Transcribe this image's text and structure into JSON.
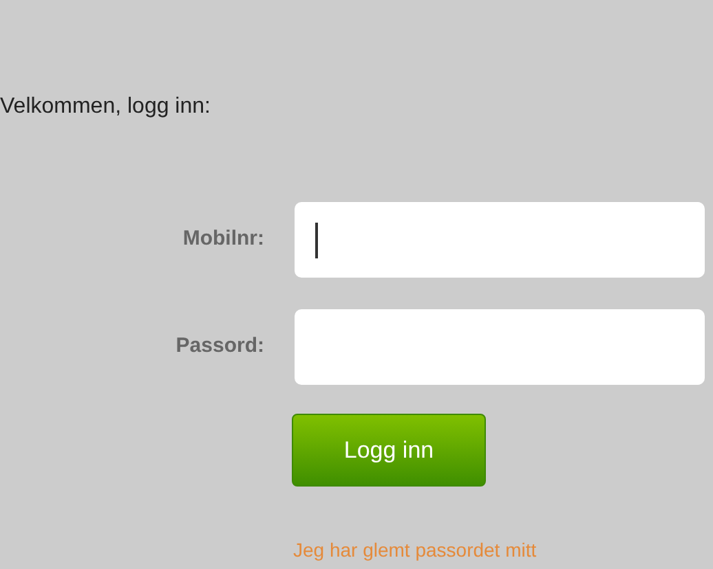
{
  "heading": "Velkommen, logg inn:",
  "fields": [
    {
      "label": "Mobilnr:",
      "focused": true
    },
    {
      "label": "Passord:",
      "focused": false
    }
  ],
  "submit_button": "Logg inn",
  "forgot_link": "Jeg har glemt passordet mitt"
}
